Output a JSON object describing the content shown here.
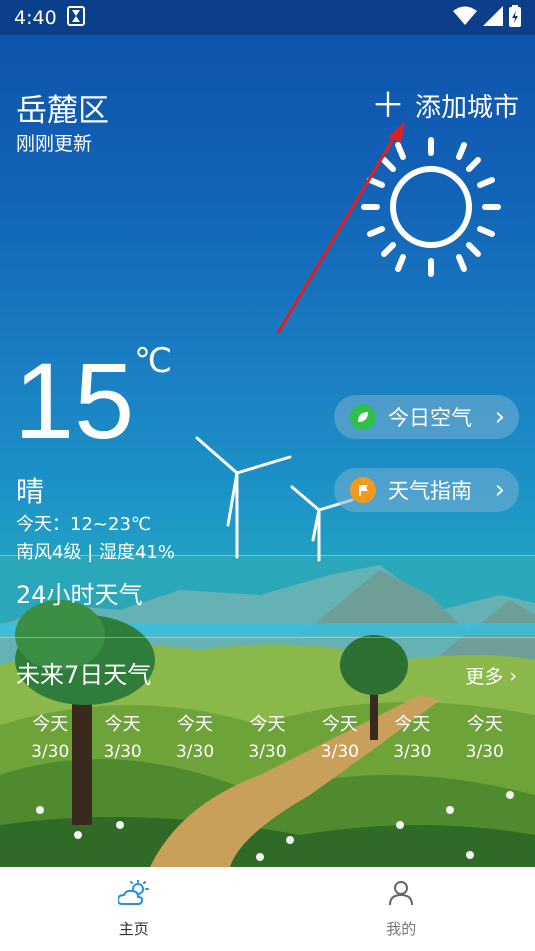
{
  "status": {
    "time": "4:40",
    "icons": [
      "hourglass-icon",
      "wifi-icon",
      "signal-icon",
      "battery-icon"
    ]
  },
  "header": {
    "city": "岳麓区",
    "updated": "刚刚更新",
    "add_city": "添加城市"
  },
  "current": {
    "temperature": "15",
    "unit": "℃",
    "condition": "晴",
    "range": "今天：12~23℃",
    "wind_humidity": "南风4级 | 湿度41%"
  },
  "buttons": {
    "air": "今日空气",
    "guide": "天气指南"
  },
  "sections": {
    "hourly_title": "24小时天气",
    "weekly_title": "未来7日天气",
    "more": "更多"
  },
  "forecast": [
    {
      "day": "今天",
      "date": "3/30"
    },
    {
      "day": "今天",
      "date": "3/30"
    },
    {
      "day": "今天",
      "date": "3/30"
    },
    {
      "day": "今天",
      "date": "3/30"
    },
    {
      "day": "今天",
      "date": "3/30"
    },
    {
      "day": "今天",
      "date": "3/30"
    },
    {
      "day": "今天",
      "date": "3/30"
    }
  ],
  "nav": {
    "home": "主页",
    "mine": "我的"
  },
  "colors": {
    "sky_top": "#0f54ae",
    "sky_bottom": "#3bb3c7",
    "air_green": "#2fbf4c",
    "guide_orange": "#f39a1e",
    "arrow_red": "#e02020"
  }
}
